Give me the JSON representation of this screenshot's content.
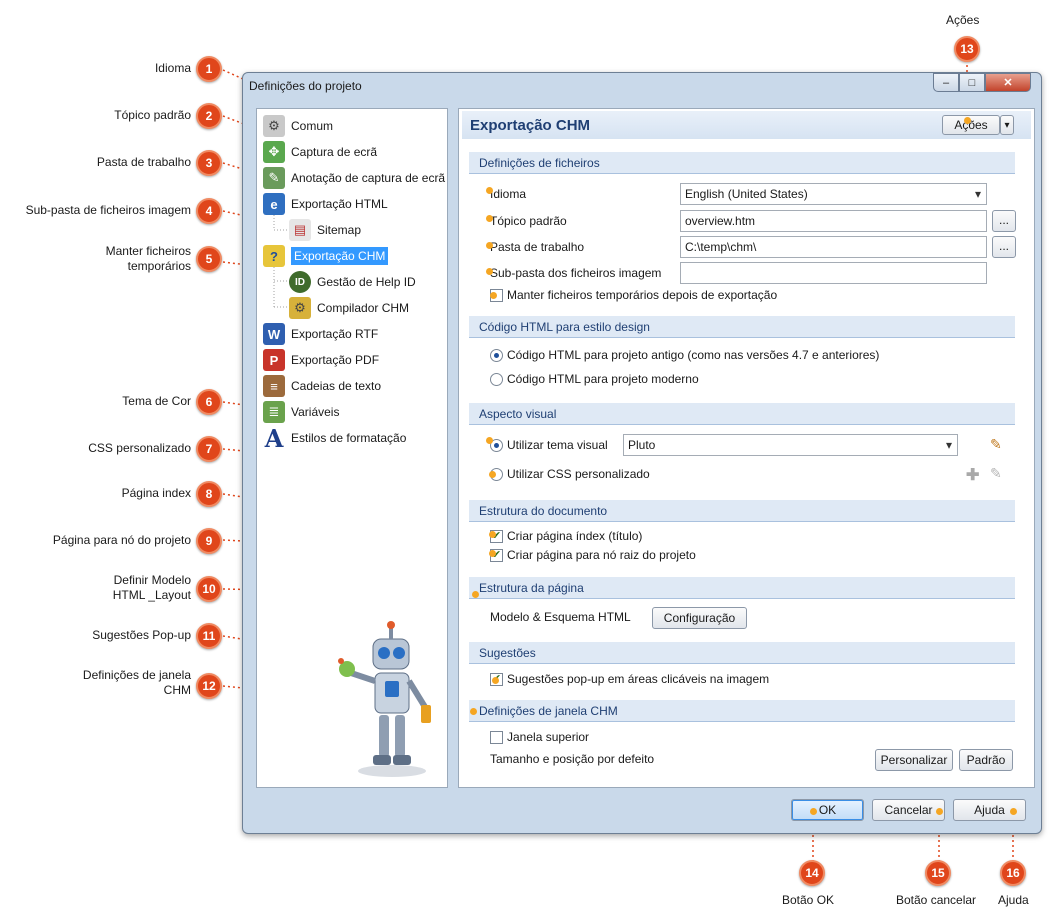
{
  "callouts": [
    {
      "num": "1",
      "label": "Idioma"
    },
    {
      "num": "2",
      "label": "Tópico padrão"
    },
    {
      "num": "3",
      "label": "Pasta de trabalho"
    },
    {
      "num": "4",
      "label": "Sub-pasta de ficheiros imagem"
    },
    {
      "num": "5",
      "label": "Manter ficheiros temporários"
    },
    {
      "num": "6",
      "label": "Tema de Cor"
    },
    {
      "num": "7",
      "label": "CSS personalizado"
    },
    {
      "num": "8",
      "label": "Página index"
    },
    {
      "num": "9",
      "label": "Página para nó do projeto"
    },
    {
      "num": "10",
      "label": "Definir Modelo HTML _Layout"
    },
    {
      "num": "11",
      "label": "Sugestões Pop-up"
    },
    {
      "num": "12",
      "label": "Definições de janela CHM"
    },
    {
      "num": "13",
      "label": "Ações"
    },
    {
      "num": "14",
      "label": "Botão OK"
    },
    {
      "num": "15",
      "label": "Botão cancelar"
    },
    {
      "num": "16",
      "label": "Ajuda"
    }
  ],
  "window": {
    "title": "Definições do projeto",
    "min": "–",
    "max": "□",
    "close": "✕"
  },
  "tree": [
    {
      "label": "Comum",
      "icon": "gear-icon",
      "glyph": "⚙"
    },
    {
      "label": "Captura de ecrã",
      "icon": "screen-capture-icon",
      "glyph": "✥"
    },
    {
      "label": "Anotação de captura de ecrã",
      "icon": "annotation-icon",
      "glyph": "✎"
    },
    {
      "label": "Exportação HTML",
      "icon": "html-export-icon",
      "glyph": "e"
    },
    {
      "label": "Sitemap",
      "icon": "sitemap-icon",
      "glyph": "▤"
    },
    {
      "label": "Exportação CHM",
      "icon": "chm-export-icon",
      "glyph": "?"
    },
    {
      "label": "Gestão de Help ID",
      "icon": "help-id-icon",
      "glyph": "ID"
    },
    {
      "label": "Compilador CHM",
      "icon": "compiler-icon",
      "glyph": "⚙"
    },
    {
      "label": "Exportação RTF",
      "icon": "rtf-export-icon",
      "glyph": "W"
    },
    {
      "label": "Exportação PDF",
      "icon": "pdf-export-icon",
      "glyph": "P"
    },
    {
      "label": "Cadeias de texto",
      "icon": "strings-icon",
      "glyph": "≡"
    },
    {
      "label": "Variáveis",
      "icon": "variables-icon",
      "glyph": "≣"
    },
    {
      "label": "Estilos de formatação",
      "icon": "styles-icon",
      "glyph": "A"
    }
  ],
  "panel": {
    "title": "Exportação CHM",
    "actions_label": "Ações",
    "sec_files": "Definições de ficheiros",
    "idioma_label": "Idioma",
    "idioma_value": "English (United States)",
    "topico_label": "Tópico padrão",
    "topico_value": "overview.htm",
    "pasta_label": "Pasta de trabalho",
    "pasta_value": "C:\\temp\\chm\\",
    "subpasta_label": "Sub-pasta dos ficheiros imagem",
    "subpasta_value": "",
    "manter_label": "Manter ficheiros temporários depois de exportação",
    "browse": "...",
    "sec_code": "Código HTML para estilo design",
    "code_old": "Código HTML para projeto antigo (como nas versões 4.7 e anteriores)",
    "code_modern": "Código HTML para projeto moderno",
    "sec_visual": "Aspecto visual",
    "tema_label": "Utilizar tema visual",
    "tema_value": "Pluto",
    "css_label": "Utilizar CSS personalizado",
    "sec_doc": "Estrutura do documento",
    "index_label": "Criar página índex (título)",
    "root_label": "Criar página para nó raiz do projeto",
    "sec_page": "Estrutura da página",
    "modelo_label": "Modelo & Esquema HTML",
    "config_btn": "Configuração",
    "sec_tips": "Sugestões",
    "popup_label": "Sugestões pop-up em áreas clicáveis na imagem",
    "sec_window": "Definições de janela CHM",
    "janela_label": "Janela superior",
    "tamanho_label": "Tamanho e posição por defeito",
    "personalizar_btn": "Personalizar",
    "padrao_btn": "Padrão"
  },
  "footer": {
    "ok": "OK",
    "cancel": "Cancelar",
    "help": "Ajuda"
  },
  "colors": {
    "callout": "#e0461b",
    "dotted": "#e0461b",
    "selection": "#3399ff",
    "section_text": "#1f3f73"
  }
}
